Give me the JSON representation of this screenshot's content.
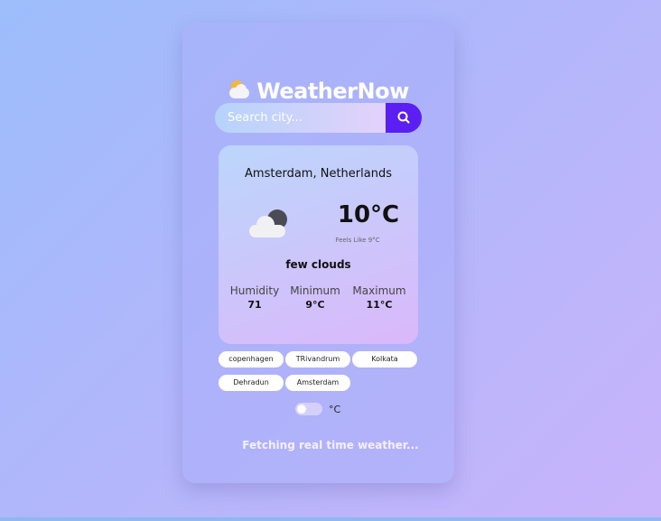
{
  "app": {
    "title": "WeatherNow",
    "logo_icon": "sun-behind-cloud-icon"
  },
  "search": {
    "placeholder": "Search city...",
    "button_icon": "search-icon"
  },
  "current": {
    "city": "Amsterdam, Netherlands",
    "icon": "cloud-with-moon-icon",
    "temperature": "10°C",
    "feels_like": "Feels Like 9°C",
    "description": "few clouds",
    "stats": [
      {
        "label": "Humidity",
        "value": "71"
      },
      {
        "label": "Minimum",
        "value": "9°C"
      },
      {
        "label": "Maximum",
        "value": "11°C"
      }
    ]
  },
  "recent_searches": [
    "copenhagen",
    "TRivandrum",
    "Kolkata",
    "Dehradun",
    "Amsterdam"
  ],
  "unit_toggle": {
    "label": "°C"
  },
  "status": "Fetching real time weather...",
  "colors": {
    "accent": "#5b1ff3",
    "card_bg": "#aab0fa"
  }
}
